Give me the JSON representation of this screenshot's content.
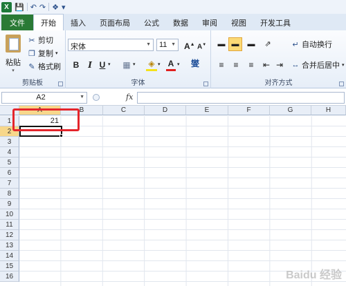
{
  "quick_access": {
    "icons": [
      "excel-icon",
      "save-icon",
      "undo-icon",
      "redo-icon",
      "customize-icon"
    ]
  },
  "tabs": [
    "文件",
    "开始",
    "插入",
    "页面布局",
    "公式",
    "数据",
    "审阅",
    "视图",
    "开发工具"
  ],
  "clipboard": {
    "paste": "粘贴",
    "cut": "剪切",
    "copy": "复制",
    "format_painter": "格式刷",
    "group_label": "剪贴板"
  },
  "font": {
    "name": "宋体",
    "size": "11",
    "bold": "B",
    "italic": "I",
    "underline": "U",
    "grow": "A",
    "shrink": "A",
    "font_color": "A",
    "phonetic": "燮",
    "group_label": "字体"
  },
  "alignment": {
    "wrap_text": "自动换行",
    "merge_center": "合并后居中",
    "group_label": "对齐方式"
  },
  "formula_bar": {
    "name_box": "A2",
    "fx": "fx",
    "value": ""
  },
  "columns": [
    "A",
    "B",
    "C",
    "D",
    "E",
    "F",
    "G",
    "H"
  ],
  "rows": [
    "1",
    "2",
    "3",
    "4",
    "5",
    "6",
    "7",
    "8",
    "9",
    "10",
    "11",
    "12",
    "13",
    "14",
    "15",
    "16"
  ],
  "cells": {
    "A1": "21"
  },
  "selected_cell": "A2",
  "watermark": "Baidu 经验",
  "colors": {
    "file_tab": "#2a7a36",
    "highlight": "#e4252b",
    "selected_header": "#f7d78b"
  }
}
